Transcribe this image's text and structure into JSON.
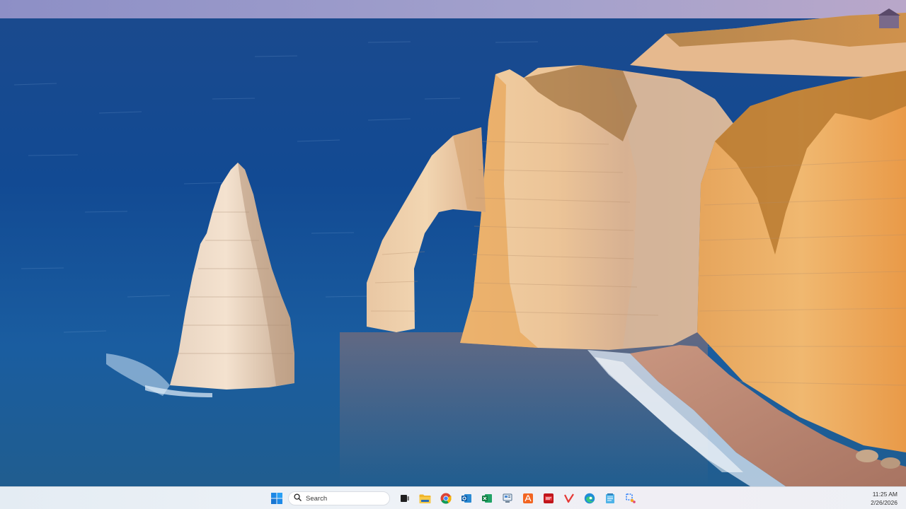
{
  "wallpaper": {
    "description_tag": "coastal-cliffs-wallpaper",
    "colors": {
      "sea_deep": "#0d3a78",
      "sea_mid": "#1b5ca3",
      "sky": "#7d8ec4",
      "cliff_light": "#f0d3a8",
      "cliff_shadow": "#c98a4a",
      "cliff_sunlit": "#e99a3c",
      "beach": "#b47c62"
    }
  },
  "taskbar": {
    "search": {
      "placeholder": "Search"
    },
    "pinned": [
      {
        "id": "start",
        "icon": "windows-start-icon"
      },
      {
        "id": "task-view",
        "icon": "task-view-icon"
      },
      {
        "id": "file-explorer",
        "icon": "folder-icon"
      },
      {
        "id": "chrome",
        "icon": "chrome-icon"
      },
      {
        "id": "outlook",
        "icon": "outlook-icon"
      },
      {
        "id": "excel",
        "icon": "excel-icon"
      },
      {
        "id": "control-panel",
        "icon": "control-panel-icon"
      },
      {
        "id": "acrobat",
        "icon": "acrobat-icon"
      },
      {
        "id": "pdf-editor",
        "icon": "pdf-icon"
      },
      {
        "id": "app-v",
        "icon": "v-app-icon"
      },
      {
        "id": "edge",
        "icon": "edge-icon"
      },
      {
        "id": "notepad",
        "icon": "notepad-icon"
      },
      {
        "id": "snipping-tool",
        "icon": "snipping-tool-icon"
      }
    ],
    "clock": {
      "time": "11:25 AM",
      "date": "2/26/2026"
    }
  }
}
